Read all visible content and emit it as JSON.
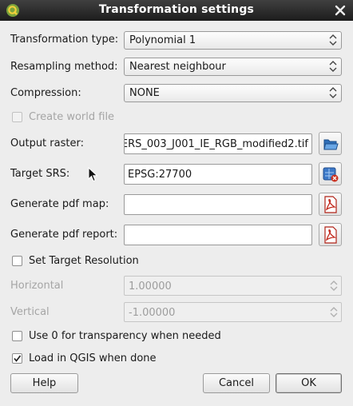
{
  "window": {
    "title": "Transformation settings"
  },
  "fields": {
    "transformation_type": {
      "label": "Transformation type:",
      "value": "Polynomial 1"
    },
    "resampling_method": {
      "label": "Resampling method:",
      "value": "Nearest neighbour"
    },
    "compression": {
      "label": "Compression:",
      "value": "NONE"
    },
    "create_world_file": {
      "label": "Create world file",
      "checked": false,
      "enabled": false
    },
    "output_raster": {
      "label": "Output raster:",
      "value": "ERS_003_J001_IE_RGB_modified2.tif"
    },
    "target_srs": {
      "label": "Target SRS:",
      "value": "EPSG:27700"
    },
    "generate_pdf_map": {
      "label": "Generate pdf map:",
      "value": ""
    },
    "generate_pdf_report": {
      "label": "Generate pdf report:",
      "value": ""
    },
    "set_target_resolution": {
      "label": "Set Target Resolution",
      "checked": false
    },
    "horizontal": {
      "label": "Horizontal",
      "value": "1.00000"
    },
    "vertical": {
      "label": "Vertical",
      "value": "-1.00000"
    },
    "use_zero_transparency": {
      "label": "Use 0 for transparency when needed",
      "checked": false
    },
    "load_in_qgis": {
      "label": "Load in QGIS when done",
      "checked": true
    }
  },
  "buttons": {
    "help": "Help",
    "cancel": "Cancel",
    "ok": "OK"
  },
  "icons": {
    "app": "qgis-logo-icon",
    "close": "close-icon",
    "browse": "folder-open-icon",
    "srs": "projection-selector-icon",
    "pdf": "pdf-icon"
  },
  "colors": {
    "titlebar": "#2a2a2a",
    "window": "#ededed",
    "pdf_red": "#c2281b"
  }
}
